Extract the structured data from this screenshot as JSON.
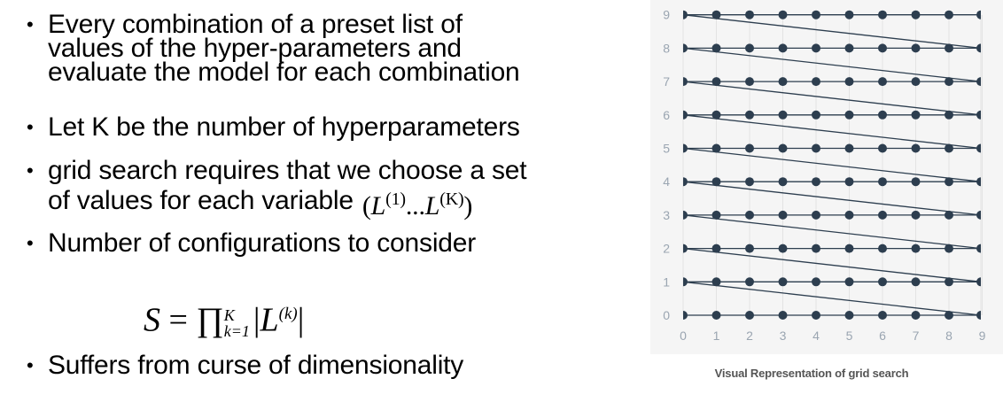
{
  "bullets": [
    "Every combination of a preset list of\nvalues of the hyper-parameters and\nevaluate the model for each combination",
    "Let K be the number of hyperparameters",
    "grid search requires that we choose a set\nof values for each variable",
    "Number of configurations to consider",
    "Suffers from curse of dimensionality"
  ],
  "bullet_marker": "•",
  "inline_math": {
    "open": "(",
    "L": "L",
    "sup1": "(1)",
    "dots": "...",
    "supK": "(K)",
    "close": ")"
  },
  "formula": {
    "lhs": "S",
    "eq": "=",
    "prod": "∏",
    "upper": "K",
    "lower": "k=1",
    "bar_open": "|",
    "L": "L",
    "sup": "(k)",
    "bar_close": "|"
  },
  "figure": {
    "caption": "Visual Representation of grid search",
    "x_ticks": [
      "0",
      "1",
      "2",
      "3",
      "4",
      "5",
      "6",
      "7",
      "8",
      "9"
    ],
    "y_ticks": [
      "0",
      "1",
      "2",
      "3",
      "4",
      "5",
      "6",
      "7",
      "8",
      "9"
    ],
    "colors": {
      "background": "#f5f5f5",
      "grid": "#e3e3e3",
      "points": "#2d3e4f",
      "ticks": "#9aa5b1"
    }
  }
}
